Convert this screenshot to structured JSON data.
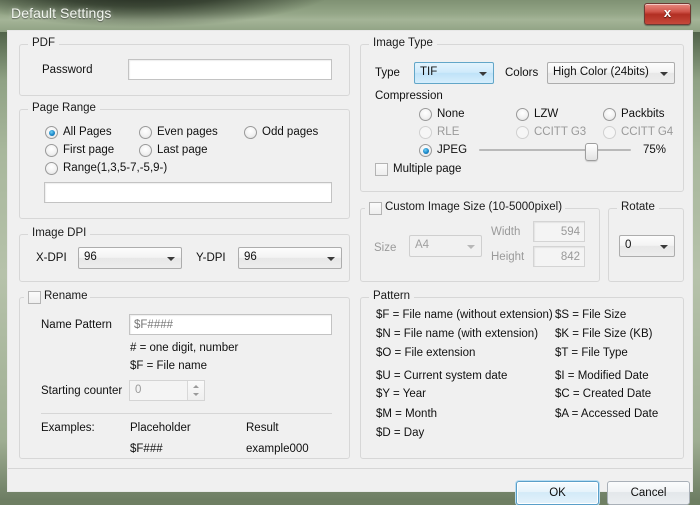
{
  "window": {
    "title": "Default Settings",
    "close_label": "x",
    "accent": "#1a86c8",
    "titlebar_color": "#94a687",
    "close_color": "#b22f22"
  },
  "pdf": {
    "caption": "PDF",
    "password_label": "Password",
    "password_value": ""
  },
  "page_range": {
    "caption": "Page Range",
    "options": [
      {
        "label": "All Pages",
        "selected": true
      },
      {
        "label": "Even pages",
        "selected": false
      },
      {
        "label": "Odd pages",
        "selected": false
      },
      {
        "label": "First page",
        "selected": false
      },
      {
        "label": "Last page",
        "selected": false
      },
      {
        "label": "Range(1,3,5-7,-5,9-)",
        "selected": false
      }
    ],
    "range_value": ""
  },
  "image_dpi": {
    "caption": "Image DPI",
    "x_label": "X-DPI",
    "x_value": "96",
    "y_label": "Y-DPI",
    "y_value": "96"
  },
  "image_type": {
    "caption": "Image Type",
    "type_label": "Type",
    "type_value": "TIF",
    "colors_label": "Colors",
    "colors_value": "High Color (24bits)",
    "compression_label": "Compression",
    "compression_options": [
      {
        "label": "None",
        "selected": false,
        "disabled": false
      },
      {
        "label": "LZW",
        "selected": false,
        "disabled": false
      },
      {
        "label": "Packbits",
        "selected": false,
        "disabled": false
      },
      {
        "label": "RLE",
        "selected": false,
        "disabled": true
      },
      {
        "label": "CCITT G3",
        "selected": false,
        "disabled": true
      },
      {
        "label": "CCITT G4",
        "selected": false,
        "disabled": true
      },
      {
        "label": "JPEG",
        "selected": true,
        "disabled": false
      }
    ],
    "quality_value": "75%",
    "quality_percent": 75,
    "multiple_page_label": "Multiple page",
    "multiple_page_checked": false
  },
  "custom_size": {
    "caption": "Custom Image Size (10-5000pixel)",
    "checked": false,
    "size_label": "Size",
    "size_value": "A4",
    "width_label": "Width",
    "width_value": "594",
    "height_label": "Height",
    "height_value": "842"
  },
  "rotate": {
    "caption": "Rotate",
    "value": "0"
  },
  "rename": {
    "caption": "Rename",
    "checked": false,
    "name_pattern_label": "Name Pattern",
    "name_pattern_placeholder": "$F####",
    "hint_digit": "# = one digit, number",
    "hint_filename": "$F = File name",
    "starting_counter_label": "Starting counter",
    "starting_counter_value": "0",
    "examples_label": "Examples:",
    "placeholder_header": "Placeholder",
    "result_header": "Result",
    "example_placeholder": "$F###",
    "example_result": "example000"
  },
  "pattern": {
    "caption": "Pattern",
    "left": [
      "$F = File name (without extension)",
      "$N = File name (with extension)",
      "$O = File extension",
      "$U = Current system date",
      "$Y = Year",
      "$M = Month",
      "$D = Day"
    ],
    "right": [
      "$S = File Size",
      "$K = File Size (KB)",
      "$T = File Type",
      "$I = Modified Date",
      "$C = Created Date",
      "$A = Accessed Date"
    ]
  },
  "footer": {
    "ok_label": "OK",
    "cancel_label": "Cancel"
  }
}
